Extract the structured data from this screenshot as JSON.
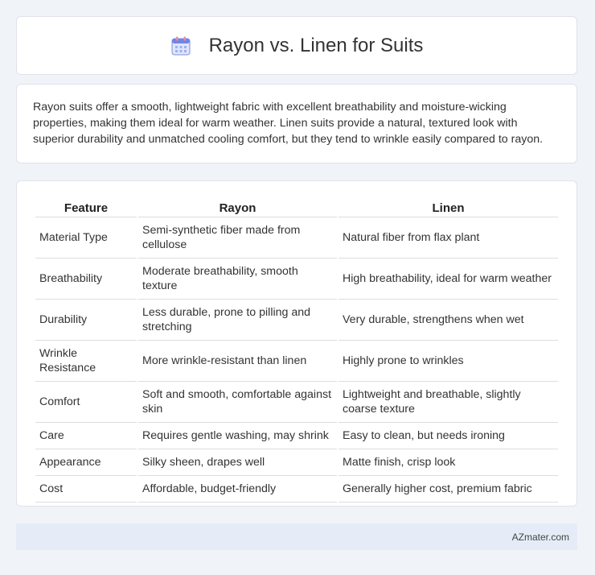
{
  "header": {
    "title": "Rayon vs. Linen for Suits",
    "icon": "calendar-icon"
  },
  "intro": {
    "text": "Rayon suits offer a smooth, lightweight fabric with excellent breathability and moisture-wicking properties, making them ideal for warm weather. Linen suits provide a natural, textured look with superior durability and unmatched cooling comfort, but they tend to wrinkle easily compared to rayon."
  },
  "table": {
    "headers": [
      "Feature",
      "Rayon",
      "Linen"
    ],
    "rows": [
      [
        "Material Type",
        "Semi-synthetic fiber made from cellulose",
        "Natural fiber from flax plant"
      ],
      [
        "Breathability",
        "Moderate breathability, smooth texture",
        "High breathability, ideal for warm weather"
      ],
      [
        "Durability",
        "Less durable, prone to pilling and stretching",
        "Very durable, strengthens when wet"
      ],
      [
        "Wrinkle Resistance",
        "More wrinkle-resistant than linen",
        "Highly prone to wrinkles"
      ],
      [
        "Comfort",
        "Soft and smooth, comfortable against skin",
        "Lightweight and breathable, slightly coarse texture"
      ],
      [
        "Care",
        "Requires gentle washing, may shrink",
        "Easy to clean, but needs ironing"
      ],
      [
        "Appearance",
        "Silky sheen, drapes well",
        "Matte finish, crisp look"
      ],
      [
        "Cost",
        "Affordable, budget-friendly",
        "Generally higher cost, premium fabric"
      ]
    ]
  },
  "footer": {
    "brand": "AZmater.com"
  },
  "colors": {
    "background": "#f0f3f8",
    "card": "#ffffff",
    "footer": "#e6ecf7"
  }
}
